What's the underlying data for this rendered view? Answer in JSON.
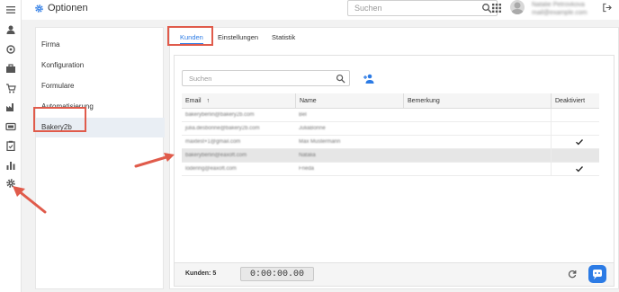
{
  "header": {
    "title": "Optionen",
    "search_placeholder": "Suchen",
    "user_line1": "Natalie Petrovkova",
    "user_line2": "mail@example.com"
  },
  "rail": {
    "icons": [
      "menu-icon",
      "person-icon",
      "target-icon",
      "briefcase-icon",
      "cart-icon",
      "factory-icon",
      "card-icon",
      "list-icon",
      "clipboard-icon",
      "bar-chart-icon",
      "gear-icon"
    ]
  },
  "left_nav": {
    "items": [
      {
        "label": "Firma"
      },
      {
        "label": "Konfiguration"
      },
      {
        "label": "Formulare"
      },
      {
        "label": "Automatisierung"
      },
      {
        "label": "Bakery2b"
      }
    ]
  },
  "tabs": [
    {
      "label": "Kunden"
    },
    {
      "label": "Einstellungen"
    },
    {
      "label": "Statistik"
    }
  ],
  "customers": {
    "search_placeholder": "Suchen",
    "columns": [
      "Email",
      "Name",
      "Bemerkung",
      "Deaktiviert"
    ],
    "sort_indicator": "↑",
    "rows": [
      {
        "email": "bakeryberlin@bakery2b.com",
        "name": "Bel",
        "note": "",
        "disabled": false
      },
      {
        "email": "julia.desbonne@bakery2b.com",
        "name": "JuliaBonne",
        "note": "",
        "disabled": false
      },
      {
        "email": "maxtest+1@gmail.com",
        "name": "Max Mustermann",
        "note": "",
        "disabled": true
      },
      {
        "email": "bakeryberlin@eaxoft.com",
        "name": "Natalia",
        "note": "",
        "disabled": false
      },
      {
        "email": "lodering@eaxoft.com",
        "name": "Frieda",
        "note": "",
        "disabled": true
      }
    ],
    "footer_count_label": "Kunden: 5",
    "timer": "0:00:00.00"
  },
  "colors": {
    "accent": "#2c7be5",
    "highlight": "#e05b4b"
  }
}
